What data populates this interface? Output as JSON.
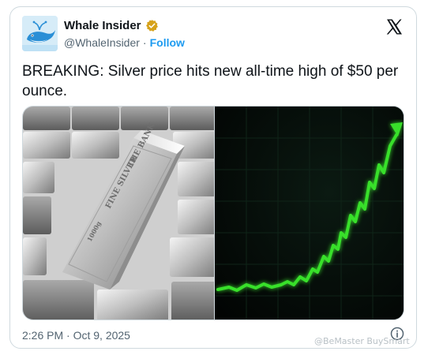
{
  "author": {
    "display_name": "Whale Insider",
    "handle": "@WhaleInsider",
    "separator": "·",
    "follow_label": "Follow",
    "verified": true,
    "verified_color": "#d6a21a",
    "avatar_icon": "whale-logo"
  },
  "tweet": {
    "text": "BREAKING: Silver price hits new all-time high of $50 per ounce.",
    "timestamp": "2:26 PM · Oct 9, 2025"
  },
  "media": {
    "left": {
      "description_icon": "silver-bars-image",
      "bar_stamp_top": "THE BANK",
      "bar_stamp_mid": "FINE SILVER",
      "bar_stamp_weight": "1000g"
    },
    "right": {
      "description_icon": "rising-green-chart-image",
      "line_color": "#38e02a"
    }
  },
  "icons": {
    "platform": "x-logo-icon",
    "info": "info-icon"
  },
  "watermark": "@BeMaster BuySmart",
  "colors": {
    "accent": "#1d9bf0",
    "text": "#0f1419",
    "muted": "#536471",
    "border": "#cfd9de"
  }
}
